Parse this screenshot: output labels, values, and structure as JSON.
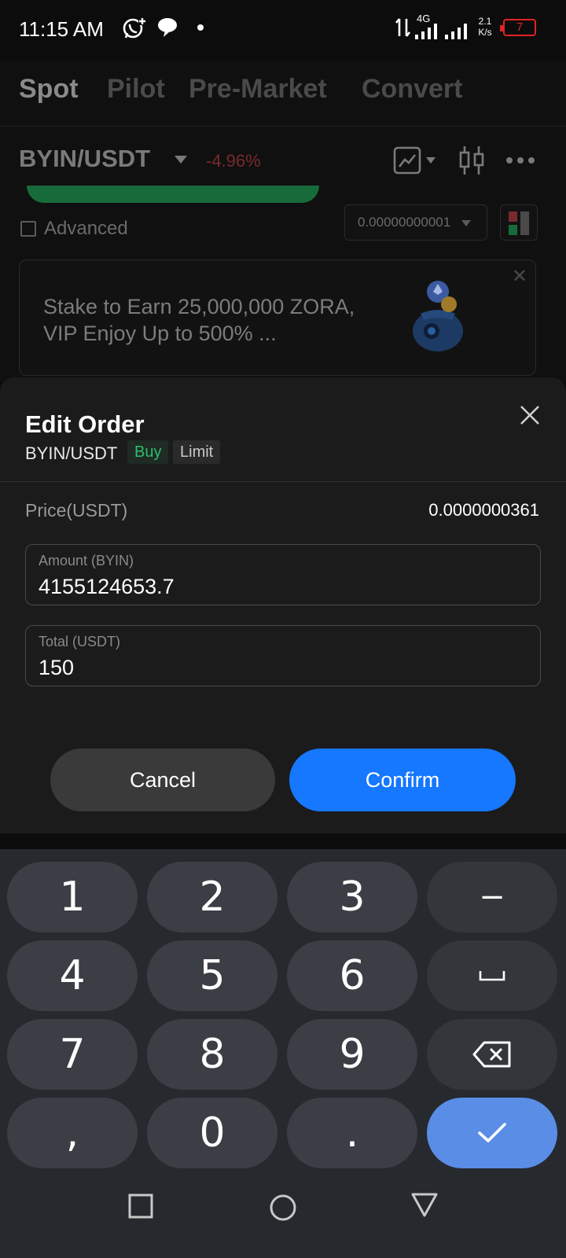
{
  "status_bar": {
    "time": "11:15 AM",
    "network": "4G",
    "speed_value": "2.1",
    "speed_unit": "K/s",
    "battery": "7",
    "battery_color": "#e02424"
  },
  "top_tabs": [
    "Spot",
    "Pilot",
    "Pre-Market",
    "Convert"
  ],
  "market": {
    "pair": "BYIN/USDT",
    "change": "-4.96%",
    "advanced_label": "Advanced",
    "precision": "0.00000000001"
  },
  "banner": {
    "text": "Stake to Earn 25,000,000 ZORA, VIP Enjoy Up to 500% ..."
  },
  "edit_order": {
    "title": "Edit Order",
    "pair": "BYIN/USDT",
    "side_tag": "Buy",
    "type_tag": "Limit",
    "price_label": "Price(USDT)",
    "price_value": "0.0000000361",
    "amount_label": "Amount (BYIN)",
    "amount_value": "4155124653.7",
    "total_label": "Total (USDT)",
    "total_value": "150",
    "cancel_label": "Cancel",
    "confirm_label": "Confirm",
    "accent_color": "#1677ff"
  },
  "keyboard": {
    "keys": [
      "1",
      "2",
      "3",
      "−",
      "4",
      "5",
      "6",
      "space-icon",
      "7",
      "8",
      "9",
      "backspace-icon",
      ",",
      "0",
      ".",
      "check-icon"
    ]
  }
}
